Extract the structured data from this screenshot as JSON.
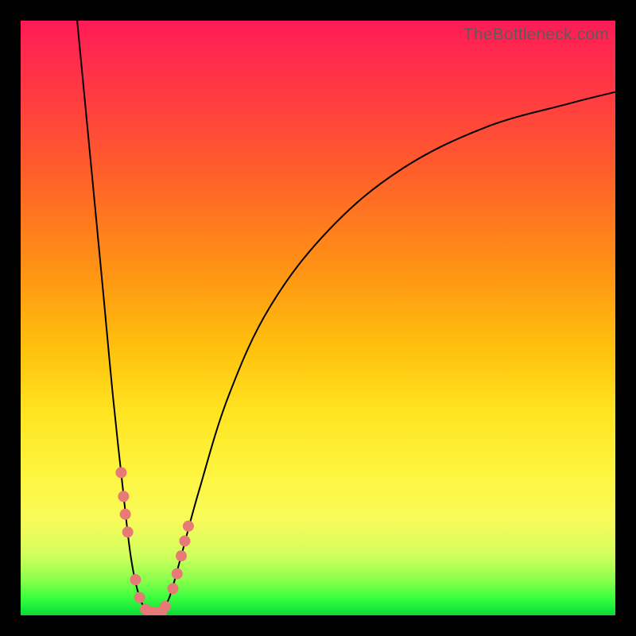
{
  "attribution": "TheBottleneck.com",
  "chart_data": {
    "type": "line",
    "title": "",
    "xlabel": "",
    "ylabel": "",
    "xlim": [
      0,
      100
    ],
    "ylim": [
      0,
      100
    ],
    "background_gradient": {
      "top": "#ff1a57",
      "bottom": "#0fd637",
      "meaning": "red_high_to_green_low"
    },
    "series": [
      {
        "name": "left-branch",
        "values_xy": [
          [
            9.5,
            100
          ],
          [
            12.0,
            74
          ],
          [
            14.0,
            53
          ],
          [
            15.5,
            37
          ],
          [
            17.0,
            23
          ],
          [
            18.5,
            10
          ],
          [
            20.0,
            3
          ],
          [
            21.5,
            0.5
          ]
        ]
      },
      {
        "name": "right-branch",
        "values_xy": [
          [
            23.5,
            0.5
          ],
          [
            25.0,
            3
          ],
          [
            27.0,
            10
          ],
          [
            30.0,
            21
          ],
          [
            35.0,
            37
          ],
          [
            42.0,
            52
          ],
          [
            52.0,
            65
          ],
          [
            64.0,
            75
          ],
          [
            78.0,
            82
          ],
          [
            92.0,
            86
          ],
          [
            100.0,
            88
          ]
        ]
      }
    ],
    "highlight_points": {
      "name": "beads",
      "values_xy": [
        [
          16.9,
          24
        ],
        [
          17.3,
          20
        ],
        [
          17.6,
          17
        ],
        [
          18.0,
          14
        ],
        [
          19.3,
          6
        ],
        [
          20.0,
          3
        ],
        [
          21.0,
          1
        ],
        [
          21.9,
          0.5
        ],
        [
          22.8,
          0.5
        ],
        [
          23.7,
          0.6
        ],
        [
          24.3,
          1.5
        ],
        [
          25.6,
          4.5
        ],
        [
          26.3,
          7
        ],
        [
          27.0,
          10
        ],
        [
          27.6,
          12.5
        ],
        [
          28.2,
          15
        ]
      ],
      "radius_px": 7
    },
    "minimum": {
      "x": 22.5,
      "y": 0.4
    }
  }
}
